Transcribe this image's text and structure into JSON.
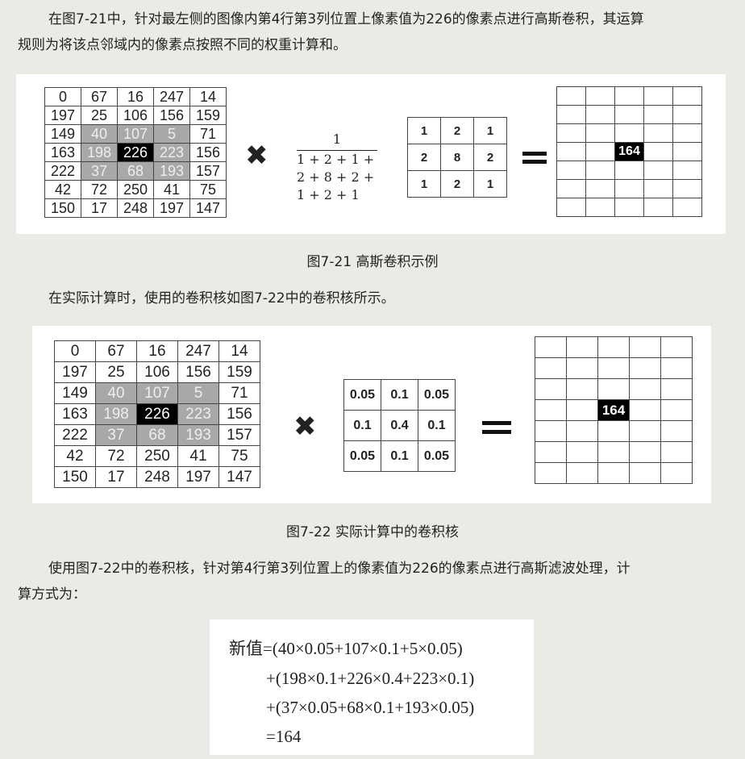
{
  "paragraphs": {
    "p1_line1": "在图7-21中，针对最左侧的图像内第4行第3列位置上像素值为226的像素点进行高斯卷积，其运算",
    "p1_line2": "规则为将该点邻域内的像素点按照不同的权重计算和。",
    "p2": "在实际计算时，使用的卷积核如图7-22中的卷积核所示。",
    "p3_line1": "使用图7-22中的卷积核，针对第4行第3列位置上的像素值为226的像素点进行高斯滤波处理，计",
    "p3_line2": "算方式为："
  },
  "image_matrix": [
    [
      "0",
      "67",
      "16",
      "247",
      "14"
    ],
    [
      "197",
      "25",
      "106",
      "156",
      "159"
    ],
    [
      "149",
      "40",
      "107",
      "5",
      "71"
    ],
    [
      "163",
      "198",
      "226",
      "223",
      "156"
    ],
    [
      "222",
      "37",
      "68",
      "193",
      "157"
    ],
    [
      "42",
      "72",
      "250",
      "41",
      "75"
    ],
    [
      "150",
      "17",
      "248",
      "197",
      "147"
    ]
  ],
  "figure1": {
    "multiply_symbol": "✖",
    "fraction_numerator": "1",
    "fraction_denominator": [
      "1 + 2 + 1 +",
      "2 + 8 + 2 +",
      "1 + 2 + 1"
    ],
    "kernel": [
      [
        "1",
        "2",
        "1"
      ],
      [
        "2",
        "8",
        "2"
      ],
      [
        "1",
        "2",
        "1"
      ]
    ],
    "result_value": "164",
    "caption": "图7-21 高斯卷积示例"
  },
  "figure2": {
    "multiply_symbol": "✖",
    "kernel": [
      [
        "0.05",
        "0.1",
        "0.05"
      ],
      [
        "0.1",
        "0.4",
        "0.1"
      ],
      [
        "0.05",
        "0.1",
        "0.05"
      ]
    ],
    "result_value": "164",
    "caption": "图7-22 实际计算中的卷积核"
  },
  "formula": {
    "lines": [
      "新值=(40×0.05+107×0.1+5×0.05)",
      "+(198×0.1+226×0.4+223×0.1)",
      "+(37×0.05+68×0.1+193×0.05)",
      "=164"
    ]
  }
}
